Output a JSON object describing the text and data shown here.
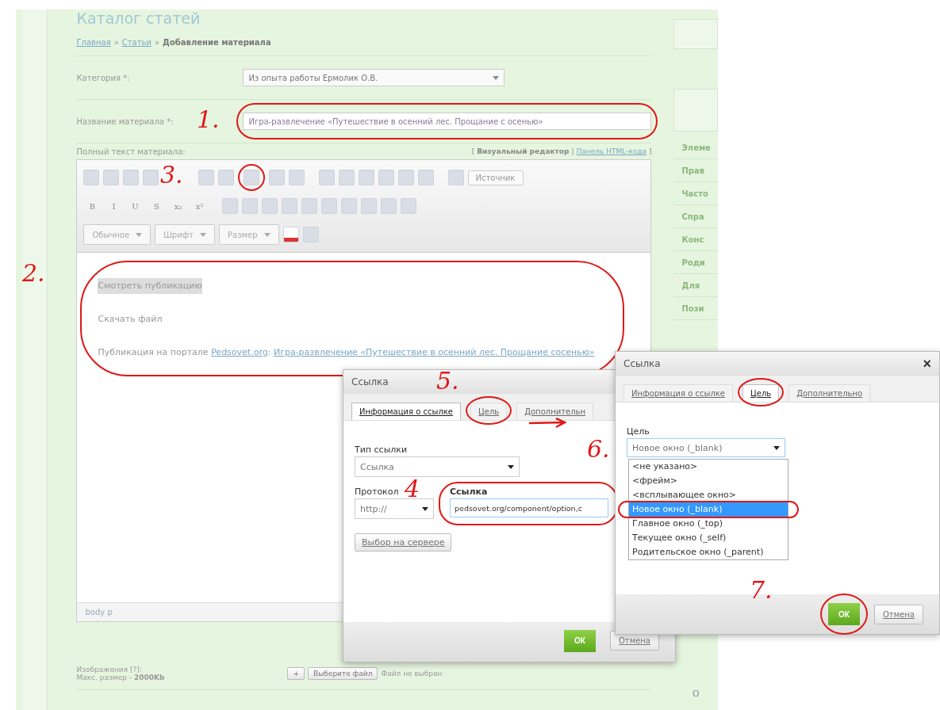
{
  "page": {
    "title": "Каталог статей",
    "breadcrumbs": [
      {
        "text": "Главная",
        "kind": "link"
      },
      {
        "text": "Статьи",
        "kind": "link"
      },
      {
        "text": "Добавление материала",
        "kind": "current"
      }
    ],
    "separator": "»",
    "category": {
      "label": "Категория *:",
      "value": "Из опыта работы Ермолик О.В."
    },
    "name_field": {
      "label": "Название материала *:",
      "value": "Игра-развлечение «Путешествие в осенний лес. Прощание с осенью»"
    },
    "fulltext": {
      "label": "Полный текст материала:",
      "open": "[",
      "current": "Визуальный редактор",
      "sep": "|",
      "link": "Панель HTML-кода",
      "close": "]"
    },
    "editor": {
      "source_button": "Источник",
      "format_buttons": [
        "B",
        "I",
        "U",
        "S",
        "x₂",
        "x²"
      ],
      "dropdowns": [
        "Обычное",
        "Шрифт",
        "Размер"
      ],
      "content": [
        {
          "kind": "highlight",
          "parts": [
            {
              "text": "Смотреть публикацию",
              "kind": "text"
            }
          ]
        },
        {
          "kind": "plain",
          "parts": [
            {
              "text": "Скачать файл",
              "kind": "text"
            }
          ]
        },
        {
          "kind": "plain",
          "parts": [
            {
              "text": "Публикация на портале ",
              "kind": "text"
            },
            {
              "text": "Pedsovet.org",
              "kind": "link"
            },
            {
              "text": ": ",
              "kind": "text"
            },
            {
              "text": "Игра-развлечение «Путешествие в осенний лес. Прощание с",
              "kind": "link"
            },
            {
              "text": "осенью»",
              "kind": "link"
            }
          ]
        }
      ],
      "path": "body p"
    },
    "images": {
      "label": "Изображения [?]:",
      "limit_label": "Макс. размер - ",
      "limit": "2000Kb",
      "add": "+",
      "choose": "Выберите файл",
      "status": "Файл не выбран"
    }
  },
  "right_sidebar": {
    "items": [
      "Элеме",
      "Прав",
      "Часто",
      "Спра",
      "Конс",
      "Роди",
      "Для",
      "Пози"
    ],
    "bottom": "О"
  },
  "dialogs": [
    {
      "kind": "info",
      "title": "Ссылка",
      "tabs": [
        {
          "label": "Информация о ссылке",
          "selected": true
        },
        {
          "label": "Цель",
          "selected": false
        },
        {
          "label": "Дополнительн",
          "selected": false
        }
      ],
      "type_label": "Тип ссылки",
      "type_value": "Ссылка",
      "protocol_label": "Протокол",
      "protocol_value": "http://",
      "url_label": "Ссылка",
      "url_value": "pedsovet.org/component/option,c",
      "browse": "Выбор на сервере",
      "ok": "ОК",
      "cancel": "Отмена"
    },
    {
      "kind": "target",
      "title": "Ссылка",
      "close": "×",
      "tabs": [
        {
          "label": "Информация о ссылке",
          "selected": false
        },
        {
          "label": "Цель",
          "selected": true
        },
        {
          "label": "Дополнительно",
          "selected": false
        }
      ],
      "target_label": "Цель",
      "target_value": "Новое окно (_blank)",
      "options": [
        {
          "label": "<не указано>",
          "selected": false
        },
        {
          "label": "<фрейм>",
          "selected": false
        },
        {
          "label": "<всплывающее окно>",
          "selected": false
        },
        {
          "label": "Новое окно (_blank)",
          "selected": true
        },
        {
          "label": "Главное окно (_top)",
          "selected": false
        },
        {
          "label": "Текущее окно (_self)",
          "selected": false
        },
        {
          "label": "Родительское окно (_parent)",
          "selected": false
        }
      ],
      "ok": "ОК",
      "cancel": "Отмена"
    }
  ],
  "annotations": [
    "1.",
    "2.",
    "3.",
    "4",
    "5.",
    "6.",
    "7."
  ]
}
